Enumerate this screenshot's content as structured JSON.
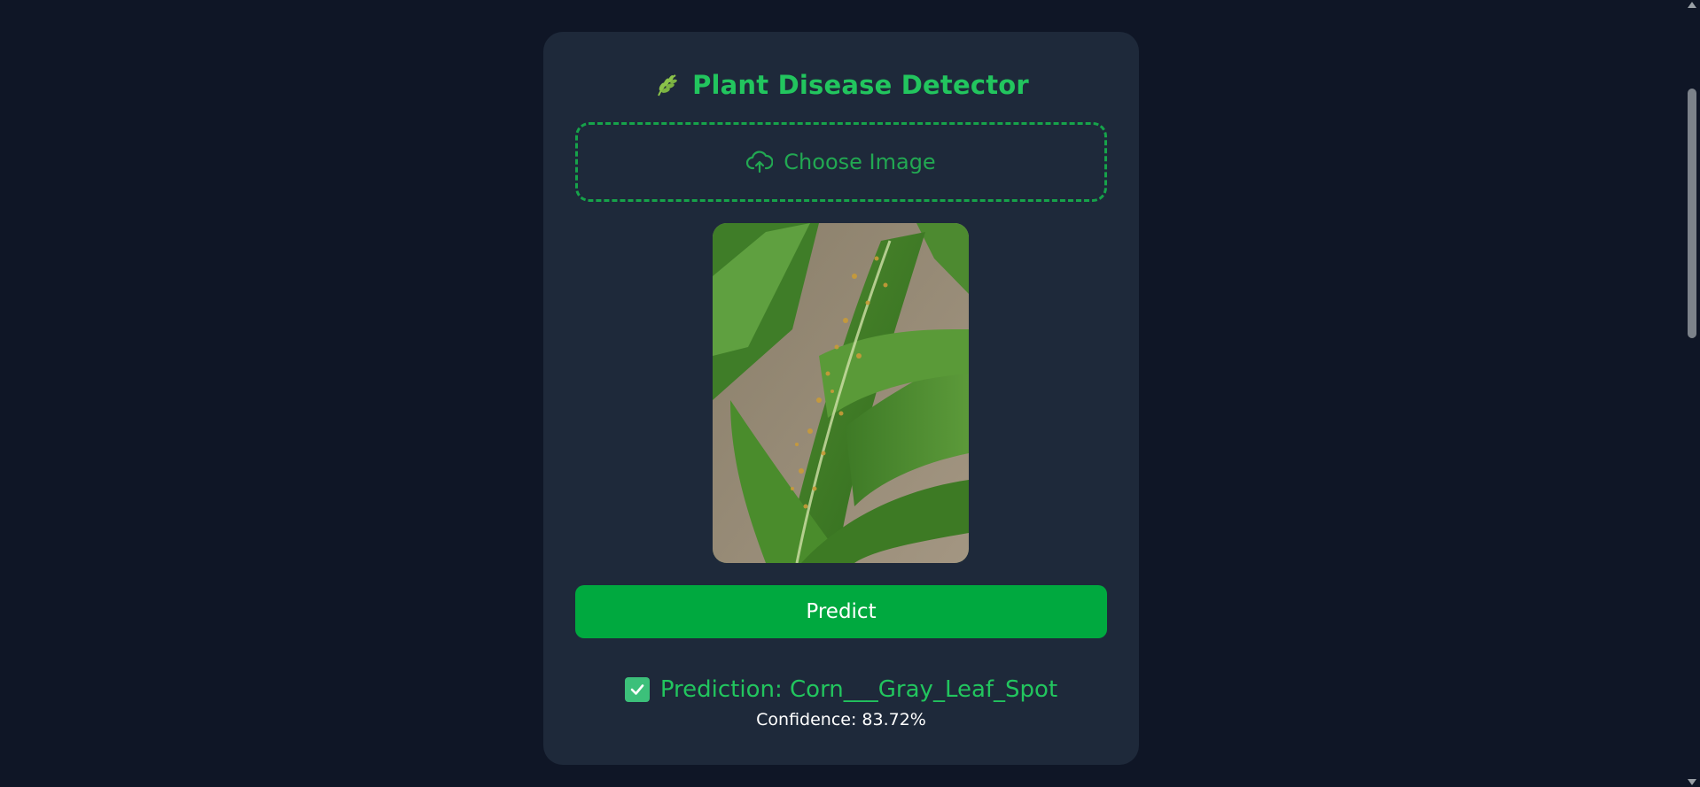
{
  "app": {
    "title": "Plant Disease Detector",
    "title_icon": "herb-icon"
  },
  "upload": {
    "label": "Choose Image",
    "icon": "cloud-upload-icon"
  },
  "preview": {
    "description_icon": "leaf-image"
  },
  "actions": {
    "predict_label": "Predict"
  },
  "result": {
    "prediction_text": "Prediction: Corn___Gray_Leaf_Spot",
    "confidence_text": "Confidence: 83.72%",
    "icon": "check-box-icon"
  },
  "colors": {
    "background": "#0f1626",
    "card": "#1e293a",
    "accent": "#22c55e",
    "button": "#00a93f"
  }
}
